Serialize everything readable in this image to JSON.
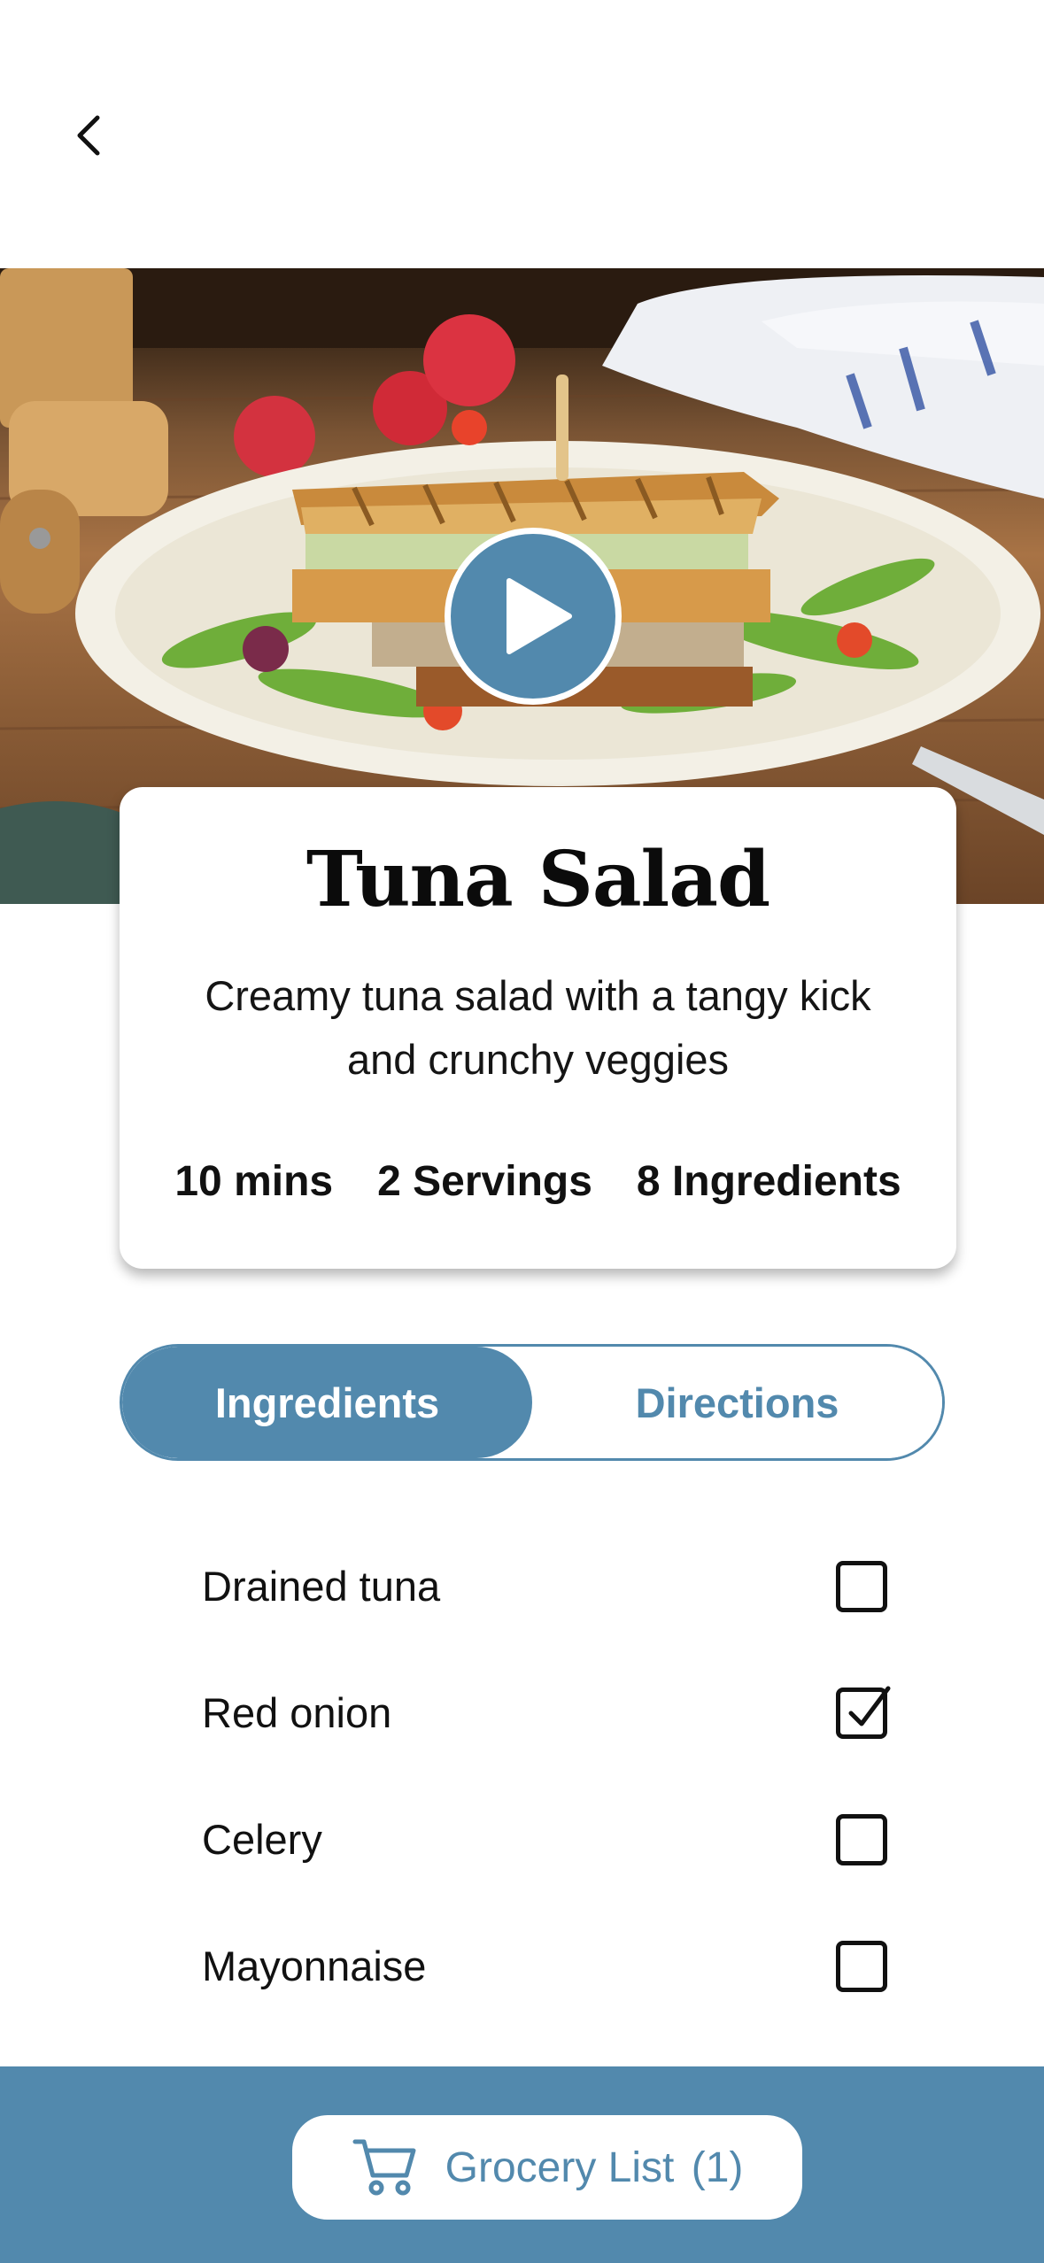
{
  "nav": {
    "back_icon": "chevron-left-icon"
  },
  "hero": {
    "image_alt": "Tuna salad sandwich on a plate",
    "play_icon": "play-icon"
  },
  "recipe": {
    "title": "Tuna Salad",
    "description": "Creamy tuna salad with a tangy kick and crunchy veggies",
    "time": "10 mins",
    "servings": "2 Servings",
    "ingredient_count": "8 Ingredients"
  },
  "tabs": [
    {
      "label": "Ingredients",
      "active": true
    },
    {
      "label": "Directions",
      "active": false
    }
  ],
  "ingredients": [
    {
      "name": "Drained tuna",
      "checked": false
    },
    {
      "name": "Red onion",
      "checked": true
    },
    {
      "name": "Celery",
      "checked": false
    },
    {
      "name": "Mayonnaise",
      "checked": false
    }
  ],
  "footer": {
    "grocery_label": "Grocery List",
    "grocery_count": "(1)",
    "cart_icon": "cart-icon"
  },
  "colors": {
    "accent": "#5289ad",
    "background": "#ffffff",
    "text": "#111111"
  }
}
